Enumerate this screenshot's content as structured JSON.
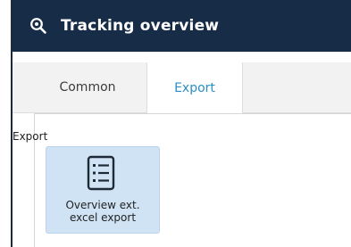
{
  "window": {
    "title": "Tracking overview",
    "title_icon": "search-icon",
    "accent_color": "#162c47"
  },
  "tabs": [
    {
      "label": "Common",
      "active": false
    },
    {
      "label": "Export",
      "active": true
    }
  ],
  "ribbon": {
    "group_label": "Export",
    "buttons": [
      {
        "label_line1": "Overview ext.",
        "label_line2": "excel export",
        "icon": "list-icon"
      }
    ]
  },
  "colors": {
    "tab_active_text": "#2a8fc5",
    "tile_background": "#cfe3f5"
  }
}
